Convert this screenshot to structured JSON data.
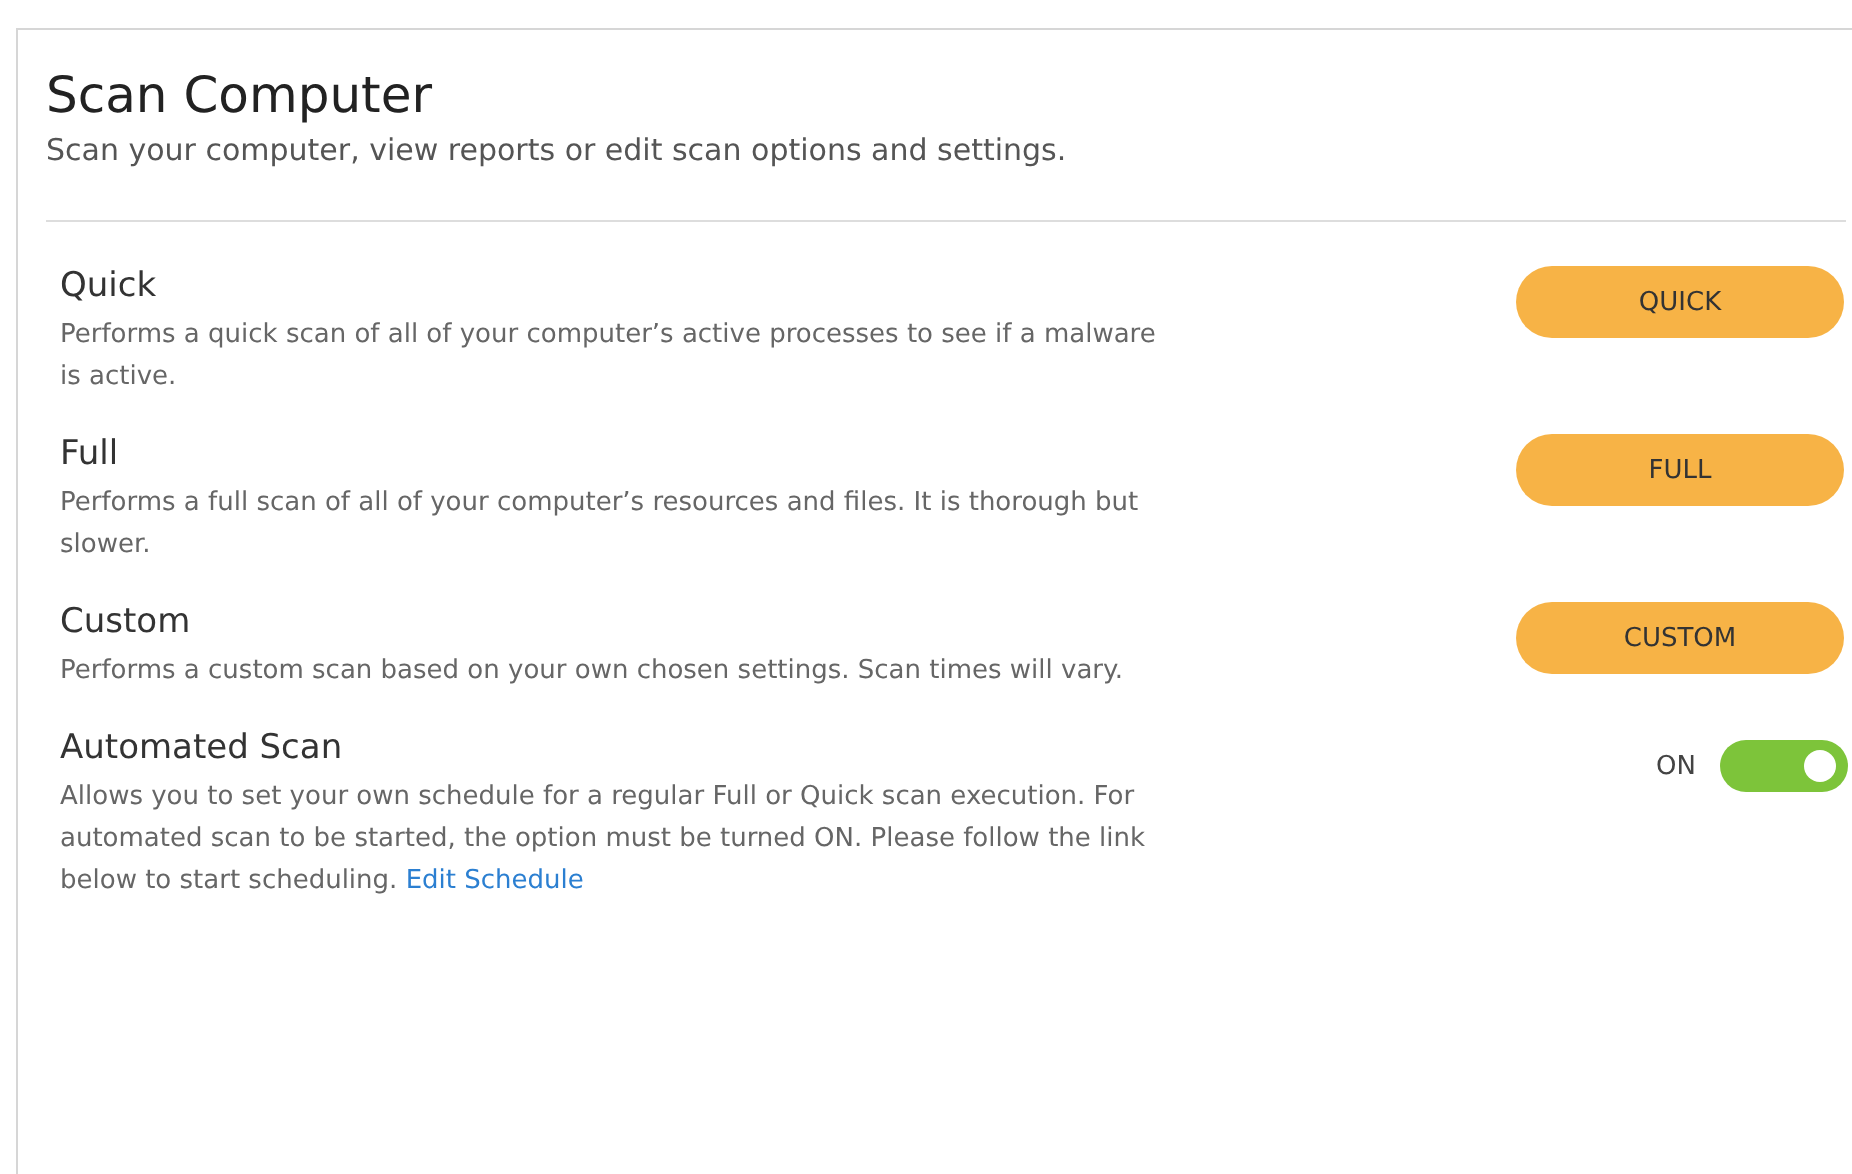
{
  "header": {
    "title": "Scan Computer",
    "subtitle": "Scan your computer, view reports or edit scan options and settings."
  },
  "options": [
    {
      "kind": "button",
      "title": "Quick",
      "description": "Performs a quick scan of all of your computer’s active processes to see if a malware is active.",
      "button": "QUICK"
    },
    {
      "kind": "button",
      "title": "Full",
      "description": "Performs a full scan of all of your computer’s resources and files. It is thorough but slower.",
      "button": "FULL"
    },
    {
      "kind": "button",
      "title": "Custom",
      "description": "Performs a custom scan based on your own chosen settings. Scan times will vary.",
      "button": "CUSTOM"
    },
    {
      "kind": "toggle",
      "title": "Automated Scan",
      "description": "Allows you to set your own schedule for a regular Full or Quick scan execution. For automated scan to be started, the option must be turned ON. Please follow the link below to start scheduling.",
      "link": "Edit Schedule",
      "toggle_label": "ON",
      "on": true
    }
  ]
}
